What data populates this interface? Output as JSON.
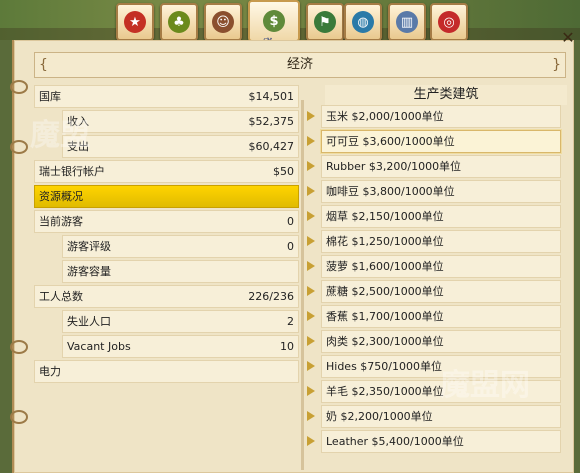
{
  "panel": {
    "title": "经济",
    "close_icon": "close-icon"
  },
  "toolbar": {
    "buttons": [
      {
        "name": "star-icon",
        "glyph": "★",
        "color": "#c43024"
      },
      {
        "name": "leaf-icon",
        "glyph": "♣",
        "color": "#6b8a1c"
      },
      {
        "name": "portrait-icon",
        "glyph": "☺",
        "color": "#8a4f2e"
      },
      {
        "name": "money-icon",
        "glyph": "$",
        "color": "#5f8a3a"
      },
      {
        "name": "flag-icon",
        "glyph": "⚑",
        "color": "#3a7a3a"
      },
      {
        "name": "globe-icon",
        "glyph": "◍",
        "color": "#2a7aa8"
      },
      {
        "name": "building-icon",
        "glyph": "▥",
        "color": "#5a7aa8"
      },
      {
        "name": "target-icon",
        "glyph": "◎",
        "color": "#c42a2a"
      }
    ]
  },
  "left": {
    "rows": [
      {
        "label": "国库",
        "value": "$14,501",
        "sub": false
      },
      {
        "label": "收入",
        "value": "$52,375",
        "sub": true
      },
      {
        "label": "支出",
        "value": "$60,427",
        "sub": true
      },
      {
        "label": "瑞士银行帐户",
        "value": "$50",
        "sub": false
      },
      {
        "label": "资源概况",
        "value": "",
        "sub": false,
        "highlight": true
      },
      {
        "label": "当前游客",
        "value": "0",
        "sub": false
      },
      {
        "label": "游客评级",
        "value": "0",
        "sub": true
      },
      {
        "label": "游客容量",
        "value": "",
        "sub": true
      },
      {
        "label": "工人总数",
        "value": "226/236",
        "sub": false
      },
      {
        "label": "失业人口",
        "value": "2",
        "sub": true
      },
      {
        "label": "Vacant Jobs",
        "value": "10",
        "sub": true
      },
      {
        "label": "电力",
        "value": "",
        "sub": false
      }
    ]
  },
  "right": {
    "heading": "生产类建筑",
    "items": [
      "玉米 $2,000/1000单位",
      "可可豆 $3,600/1000单位",
      "Rubber $3,200/1000单位",
      "咖啡豆 $3,800/1000单位",
      "烟草 $2,150/1000单位",
      "棉花 $1,250/1000单位",
      "菠萝 $1,600/1000单位",
      "蔗糖 $2,500/1000单位",
      "香蕉 $1,700/1000单位",
      "肉类 $2,300/1000单位",
      "Hides $750/1000单位",
      "羊毛 $2,350/1000单位",
      "奶 $2,200/1000单位",
      "Leather $5,400/1000单位"
    ],
    "active_index": 1
  },
  "watermark": "魔盟网"
}
